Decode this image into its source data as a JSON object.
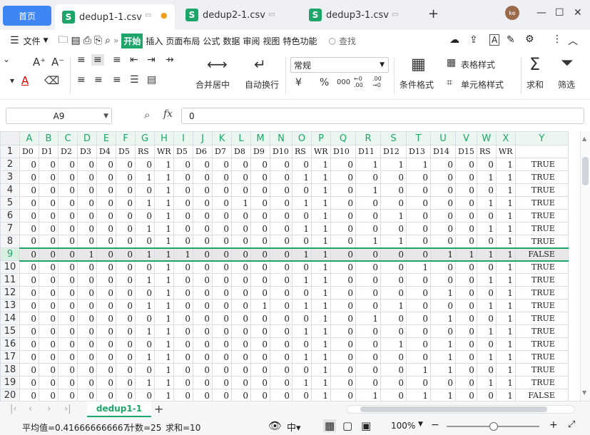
{
  "tabs": {
    "home": "首页",
    "files": [
      {
        "name": "dedup1-1.csv",
        "active": true
      },
      {
        "name": "dedup2-1.csv",
        "active": false
      },
      {
        "name": "dedup3-1.csv",
        "active": false
      }
    ],
    "new_tab": "+",
    "avatar": "ke"
  },
  "menu": {
    "file": "文件",
    "items": [
      "开始",
      "插入",
      "页面布局",
      "公式",
      "数据",
      "审阅",
      "视图",
      "特色功能"
    ],
    "search": "查找"
  },
  "ribbon": {
    "merge_center": "合并居中",
    "wrap_text": "自动换行",
    "number_format": "常规",
    "table_style": "表格样式",
    "cond_format": "条件格式",
    "cell_style": "单元格样式",
    "sum": "求和",
    "filter": "筛选",
    "currency": "¥",
    "percent": "%",
    "thousands": "000",
    "dec_inc": "←0 .00",
    "dec_dec": ".00 →0"
  },
  "formula_bar": {
    "cell_ref": "A9",
    "fx": "fx",
    "value": "0"
  },
  "grid": {
    "columns": [
      "A",
      "B",
      "C",
      "D",
      "E",
      "F",
      "G",
      "H",
      "I",
      "J",
      "K",
      "L",
      "M",
      "N",
      "O",
      "P",
      "Q",
      "R",
      "S",
      "T",
      "U",
      "V",
      "W",
      "X",
      "Y"
    ],
    "headers": [
      "D0",
      "D1",
      "D2",
      "D3",
      "D4",
      "D5",
      "RS",
      "WR",
      "D5",
      "D6",
      "D7",
      "D8",
      "D9",
      "D10",
      "RS",
      "WR",
      "D10",
      "D11",
      "D12",
      "D13",
      "D14",
      "D15",
      "RS",
      "WR",
      ""
    ],
    "selected_row": 9,
    "rows": [
      [
        0,
        0,
        0,
        0,
        0,
        0,
        0,
        1,
        0,
        0,
        0,
        0,
        0,
        0,
        0,
        1,
        0,
        1,
        1,
        1,
        0,
        0,
        0,
        1,
        "TRUE"
      ],
      [
        0,
        0,
        0,
        0,
        0,
        0,
        1,
        1,
        0,
        0,
        0,
        0,
        0,
        0,
        1,
        1,
        0,
        0,
        0,
        0,
        0,
        0,
        1,
        1,
        "TRUE"
      ],
      [
        0,
        0,
        0,
        0,
        0,
        0,
        0,
        1,
        0,
        0,
        0,
        0,
        0,
        0,
        0,
        1,
        0,
        1,
        0,
        0,
        0,
        0,
        0,
        1,
        "TRUE"
      ],
      [
        0,
        0,
        0,
        0,
        0,
        0,
        1,
        1,
        0,
        0,
        0,
        1,
        0,
        0,
        1,
        1,
        0,
        0,
        0,
        0,
        0,
        0,
        1,
        1,
        "TRUE"
      ],
      [
        0,
        0,
        0,
        0,
        0,
        0,
        0,
        1,
        0,
        0,
        0,
        0,
        0,
        0,
        0,
        1,
        0,
        0,
        1,
        0,
        0,
        0,
        0,
        1,
        "TRUE"
      ],
      [
        0,
        0,
        0,
        0,
        0,
        0,
        1,
        1,
        0,
        0,
        0,
        0,
        0,
        0,
        1,
        1,
        0,
        0,
        0,
        0,
        0,
        0,
        1,
        1,
        "TRUE"
      ],
      [
        0,
        0,
        0,
        0,
        0,
        0,
        0,
        1,
        0,
        0,
        0,
        0,
        0,
        0,
        0,
        1,
        0,
        1,
        1,
        0,
        0,
        0,
        0,
        1,
        "TRUE"
      ],
      [
        0,
        0,
        0,
        1,
        0,
        0,
        1,
        1,
        1,
        0,
        0,
        0,
        0,
        0,
        1,
        1,
        0,
        0,
        0,
        0,
        1,
        1,
        1,
        1,
        "FALSE"
      ],
      [
        0,
        0,
        0,
        0,
        0,
        0,
        0,
        1,
        0,
        0,
        0,
        0,
        0,
        0,
        0,
        1,
        0,
        0,
        0,
        1,
        0,
        0,
        0,
        1,
        "TRUE"
      ],
      [
        0,
        0,
        0,
        0,
        0,
        0,
        1,
        1,
        0,
        0,
        0,
        0,
        0,
        0,
        1,
        1,
        0,
        0,
        0,
        0,
        0,
        0,
        1,
        1,
        "TRUE"
      ],
      [
        0,
        0,
        0,
        0,
        0,
        0,
        0,
        1,
        0,
        0,
        0,
        0,
        0,
        0,
        0,
        1,
        0,
        0,
        0,
        0,
        1,
        0,
        0,
        1,
        "TRUE"
      ],
      [
        0,
        0,
        0,
        0,
        0,
        0,
        1,
        1,
        0,
        0,
        0,
        0,
        1,
        0,
        1,
        1,
        0,
        0,
        1,
        0,
        0,
        0,
        1,
        1,
        "TRUE"
      ],
      [
        0,
        0,
        0,
        0,
        0,
        0,
        0,
        1,
        0,
        0,
        0,
        0,
        0,
        0,
        0,
        1,
        0,
        1,
        0,
        0,
        1,
        0,
        0,
        1,
        "TRUE"
      ],
      [
        0,
        0,
        0,
        0,
        0,
        0,
        1,
        1,
        0,
        0,
        0,
        0,
        0,
        0,
        1,
        1,
        0,
        0,
        0,
        0,
        0,
        0,
        1,
        1,
        "TRUE"
      ],
      [
        0,
        0,
        0,
        0,
        0,
        0,
        0,
        1,
        0,
        0,
        0,
        0,
        0,
        0,
        0,
        1,
        0,
        0,
        1,
        0,
        1,
        0,
        0,
        1,
        "TRUE"
      ],
      [
        0,
        0,
        0,
        0,
        0,
        0,
        1,
        1,
        0,
        0,
        0,
        0,
        0,
        0,
        1,
        1,
        0,
        0,
        0,
        0,
        1,
        0,
        1,
        1,
        "TRUE"
      ],
      [
        0,
        0,
        0,
        0,
        0,
        0,
        0,
        1,
        0,
        0,
        0,
        0,
        0,
        0,
        0,
        1,
        0,
        0,
        0,
        1,
        1,
        0,
        0,
        1,
        "TRUE"
      ],
      [
        0,
        0,
        0,
        0,
        0,
        0,
        1,
        1,
        0,
        0,
        0,
        0,
        0,
        0,
        1,
        1,
        0,
        0,
        0,
        0,
        0,
        0,
        1,
        1,
        "TRUE"
      ],
      [
        0,
        0,
        0,
        0,
        0,
        0,
        0,
        1,
        0,
        0,
        0,
        0,
        0,
        0,
        0,
        1,
        0,
        1,
        0,
        1,
        1,
        0,
        0,
        1,
        "FALSE"
      ]
    ]
  },
  "sheet_bar": {
    "active_sheet": "dedup1-1",
    "add": "+"
  },
  "status_bar": {
    "average": "平均值=0.416666666667",
    "count": "计数=25",
    "sum": "求和=10",
    "zoom": "100%"
  },
  "colors": {
    "accent_green": "#1ea56a",
    "tab_blue": "#3f86f5"
  }
}
